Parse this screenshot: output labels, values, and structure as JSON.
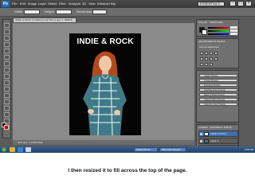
{
  "app": {
    "logo_text": "Ps",
    "menu": [
      "File",
      "Edit",
      "Image",
      "Layer",
      "Select",
      "Filter",
      "Analysis",
      "3D",
      "View",
      "Window",
      "Help"
    ],
    "window_buttons": [
      "–",
      "□",
      "×"
    ]
  },
  "options_bar": {
    "width_label": "Width:",
    "height_label": "Height:",
    "resolution_label": "Resolution:",
    "width_value": "",
    "height_value": "",
    "resolution_value": "",
    "workspace": "ESSENTIALS"
  },
  "document": {
    "tab_title": "INDIE & ROCK COVER.psd @ 50% (Layer 1, RGB/8)",
    "artwork_title": "INDIE & ROCK",
    "status": "50%   Doc: 1.37M/5.96M"
  },
  "panels": {
    "color_tabs": [
      "COLOR",
      "SWATCHES"
    ],
    "adjustments_tabs": [
      "ADJUSTMENTS",
      "MASKS"
    ],
    "adjustments_hint": "Add an adjustment",
    "styles": [
      "Levels Presets",
      "Curves Presets",
      "Exposure Presets",
      "Hue/Saturation Presets",
      "Black & White Presets",
      "Channel Mixer Presets",
      "Selective Color Presets"
    ],
    "layers_tabs": [
      "LAYERS",
      "CHANNELS",
      "PATHS"
    ],
    "layers": [
      {
        "name": "INDIE & ROCK",
        "type": "text"
      },
      {
        "name": "Layer 1",
        "type": "image"
      },
      {
        "name": "Background",
        "type": "fill"
      }
    ]
  },
  "taskbar": {
    "buttons": [
      "Adobe Photo...",
      "Microsoft PowerP..."
    ],
    "clock": "3:25 PM"
  },
  "caption": "I then resized it to fill across the top of the page.",
  "colors": {
    "foreground": "#111111",
    "background_swatch": "#cc0000",
    "taskbar": "#2f5186"
  },
  "icons": [
    "photoshop-logo-icon",
    "tool-icons",
    "eye-icon",
    "start-orb-icon"
  ]
}
